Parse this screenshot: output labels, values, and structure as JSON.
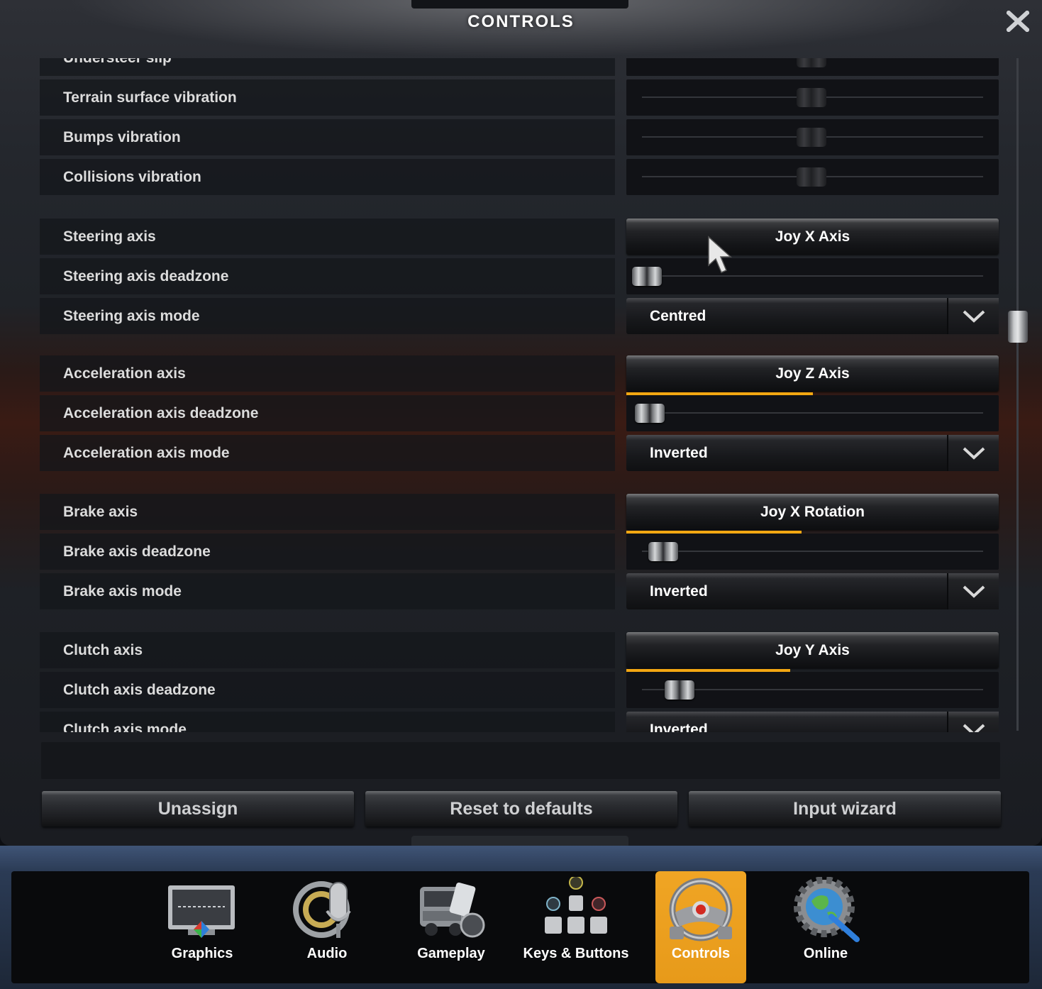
{
  "window": {
    "title": "CONTROLS"
  },
  "rows": {
    "understeer_slip": "Understeer slip",
    "terrain_vibration": "Terrain surface vibration",
    "bumps_vibration": "Bumps vibration",
    "collisions_vibration": "Collisions vibration",
    "steering_axis": "Steering axis",
    "steering_deadzone": "Steering axis deadzone",
    "steering_mode": "Steering axis mode",
    "acceleration_axis": "Acceleration axis",
    "acceleration_deadzone": "Acceleration axis deadzone",
    "acceleration_mode": "Acceleration axis mode",
    "brake_axis": "Brake axis",
    "brake_deadzone": "Brake axis deadzone",
    "brake_mode": "Brake axis mode",
    "clutch_axis": "Clutch axis",
    "clutch_deadzone": "Clutch axis deadzone",
    "clutch_mode": "Clutch axis mode"
  },
  "values": {
    "steering_axis": "Joy X Axis",
    "steering_mode": "Centred",
    "acceleration_axis": "Joy Z Axis",
    "acceleration_mode": "Inverted",
    "brake_axis": "Joy X Rotation",
    "brake_mode": "Inverted",
    "clutch_axis": "Joy Y Axis",
    "clutch_mode": "Inverted"
  },
  "input_levels": {
    "acceleration": 0.5,
    "brake": 0.47,
    "clutch": 0.44
  },
  "slider_levels": {
    "understeer_slip": 0.5,
    "terrain_vibration": 0.5,
    "bumps_vibration": 0.5,
    "collisions_vibration": 0.5,
    "steering_deadzone": 0.0,
    "acceleration_deadzone": 0.01,
    "brake_deadzone": 0.06,
    "clutch_deadzone": 0.11
  },
  "buttons": {
    "unassign": "Unassign",
    "reset": "Reset to defaults",
    "wizard": "Input wizard"
  },
  "nav": [
    {
      "label": "Graphics",
      "icon": "monitor-icon"
    },
    {
      "label": "Audio",
      "icon": "microphone-icon"
    },
    {
      "label": "Gameplay",
      "icon": "truck-icon"
    },
    {
      "label": "Keys & Buttons",
      "icon": "gamepad-buttons-icon"
    },
    {
      "label": "Controls",
      "icon": "steering-wheel-icon",
      "active": true
    },
    {
      "label": "Online",
      "icon": "globe-gear-icon"
    }
  ],
  "colors": {
    "accent": "#f3a712",
    "active_tab": "#eea020"
  }
}
